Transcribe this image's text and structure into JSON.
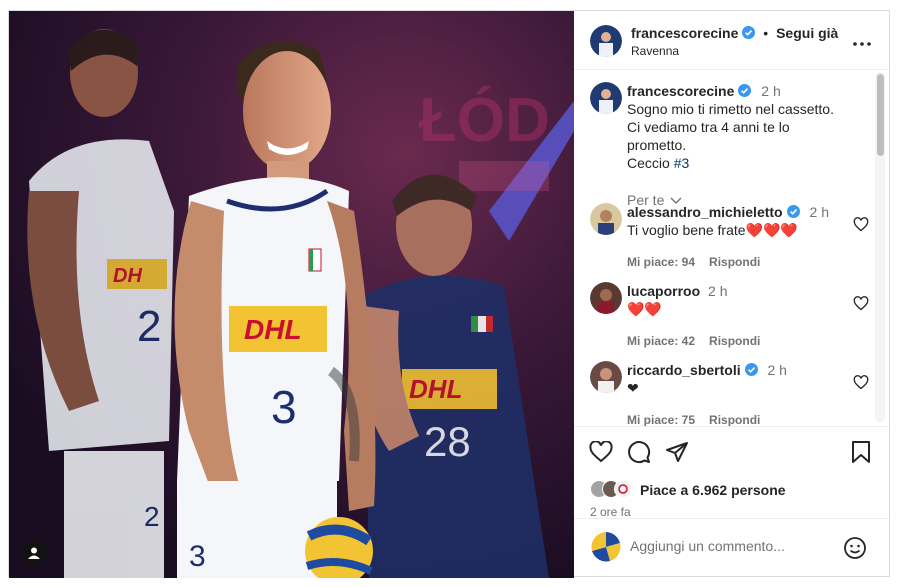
{
  "header": {
    "username": "francescorecine",
    "separator": "•",
    "follow_label": "Segui già",
    "location": "Ravenna"
  },
  "caption": {
    "username": "francescorecine",
    "time": "2 h",
    "line1": "Sogno mio ti rimetto nel cassetto.",
    "line2": "Ci vediamo tra 4 anni te lo prometto.",
    "line3_text": "Ceccio",
    "line3_hashtag": "#3",
    "translation_label": "Per te"
  },
  "comments": [
    {
      "username": "alessandro_michieletto",
      "verified": true,
      "time": "2 h",
      "text": "Ti voglio bene frate❤️❤️❤️",
      "likes": "Mi piace: 94",
      "reply": "Rispondi"
    },
    {
      "username": "lucaporroo",
      "verified": false,
      "time": "2 h",
      "text": "❤️❤️",
      "likes": "Mi piace: 42",
      "reply": "Rispondi"
    },
    {
      "username": "riccardo_sbertoli",
      "verified": true,
      "time": "2 h",
      "text": "❤",
      "likes": "Mi piace: 75",
      "reply": "Rispondi"
    }
  ],
  "likes_text": "Piace a 6.962 persone",
  "post_time": "2 ore fa",
  "add_comment_placeholder": "Aggiungi un commento...",
  "jersey": {
    "sponsor": "DHL",
    "front_number": "3",
    "back_number": "28",
    "left_number": "2"
  },
  "colors": {
    "link": "#00376b",
    "verified": "#3897f0",
    "muted": "#737373"
  },
  "icons": [
    "heart-icon",
    "comment-icon",
    "share-icon",
    "bookmark-icon",
    "more-icon",
    "emoji-icon",
    "user-tag-icon"
  ]
}
